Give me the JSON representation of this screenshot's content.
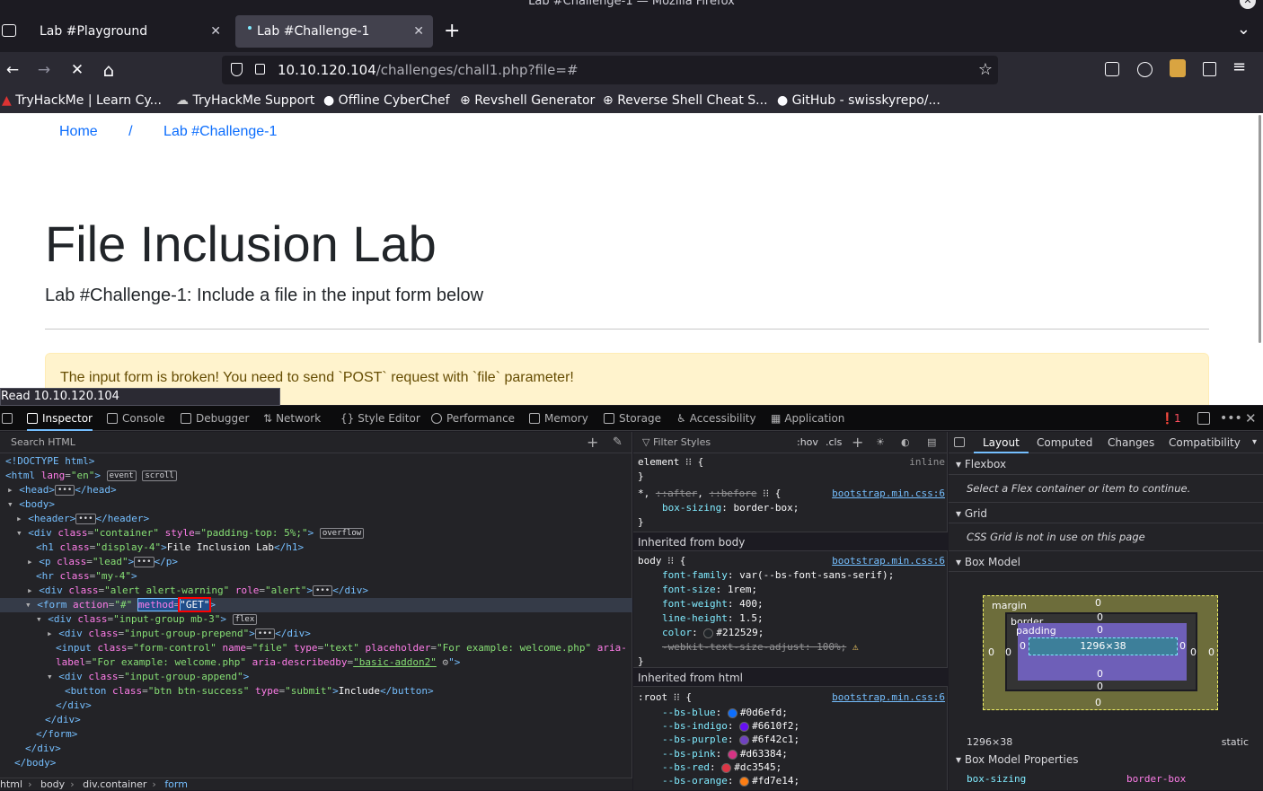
{
  "window": {
    "title": "Lab #Challenge-1 — Mozilla Firefox",
    "close_glyph": "✕"
  },
  "tabs": [
    {
      "label": "Lab #Playground",
      "close": "✕"
    },
    {
      "label": "Lab #Challenge-1",
      "close": "✕"
    }
  ],
  "new_tab": "+",
  "tab_list": "⌄",
  "nav": {
    "back": "←",
    "forward": "→",
    "reload": "✕",
    "home": "⌂",
    "url_host": "10.10.120.104",
    "url_path": "/challenges/chall1.php?file=#",
    "star": "☆",
    "menu": "≡"
  },
  "bookmarks": [
    {
      "label": "TryHackMe | Learn Cy..."
    },
    {
      "label": "TryHackMe Support"
    },
    {
      "label": "Offline CyberChef"
    },
    {
      "label": "Revshell Generator"
    },
    {
      "label": "Reverse Shell Cheat S..."
    },
    {
      "label": "GitHub - swisskyrepo/..."
    }
  ],
  "page": {
    "breadcrumb_home": "Home",
    "breadcrumb_sep": "/",
    "breadcrumb_current": "Lab #Challenge-1",
    "title": "File Inclusion Lab",
    "lead": "Lab #Challenge-1: Include a file in the input form below",
    "alert": "The input form is broken! You need to send `POST` request with `file` parameter!"
  },
  "status_text": "Read 10.10.120.104",
  "devtools": {
    "tabs": [
      "Inspector",
      "Console",
      "Debugger",
      "Network",
      "Style Editor",
      "Performance",
      "Memory",
      "Storage",
      "Accessibility",
      "Application"
    ],
    "error_count": "1",
    "search_html": "Search HTML",
    "filter_styles": "Filter Styles",
    "hov": ":hov",
    "cls": ".cls",
    "breadcrumbs": [
      "html",
      "body",
      "div.container",
      "form"
    ],
    "layout_tabs": [
      "Layout",
      "Computed",
      "Changes",
      "Compatibility"
    ],
    "flexbox": {
      "title": "Flexbox",
      "msg": "Select a Flex container or item to continue."
    },
    "grid": {
      "title": "Grid",
      "msg": "CSS Grid is not in use on this page"
    },
    "boxmodel": {
      "title": "Box Model",
      "margin": "margin",
      "border": "border",
      "padding": "padding",
      "content": "1296×38",
      "zero": "0",
      "size": "1296×38",
      "position": "static"
    },
    "boxprops": {
      "title": "Box Model Properties",
      "name": "box-sizing",
      "value": "border-box"
    }
  },
  "colors": {
    "accent": "#0d6efd",
    "alert_bg": "#fff3cd",
    "alert_text": "#664d03",
    "highlight": "#ff0000"
  }
}
